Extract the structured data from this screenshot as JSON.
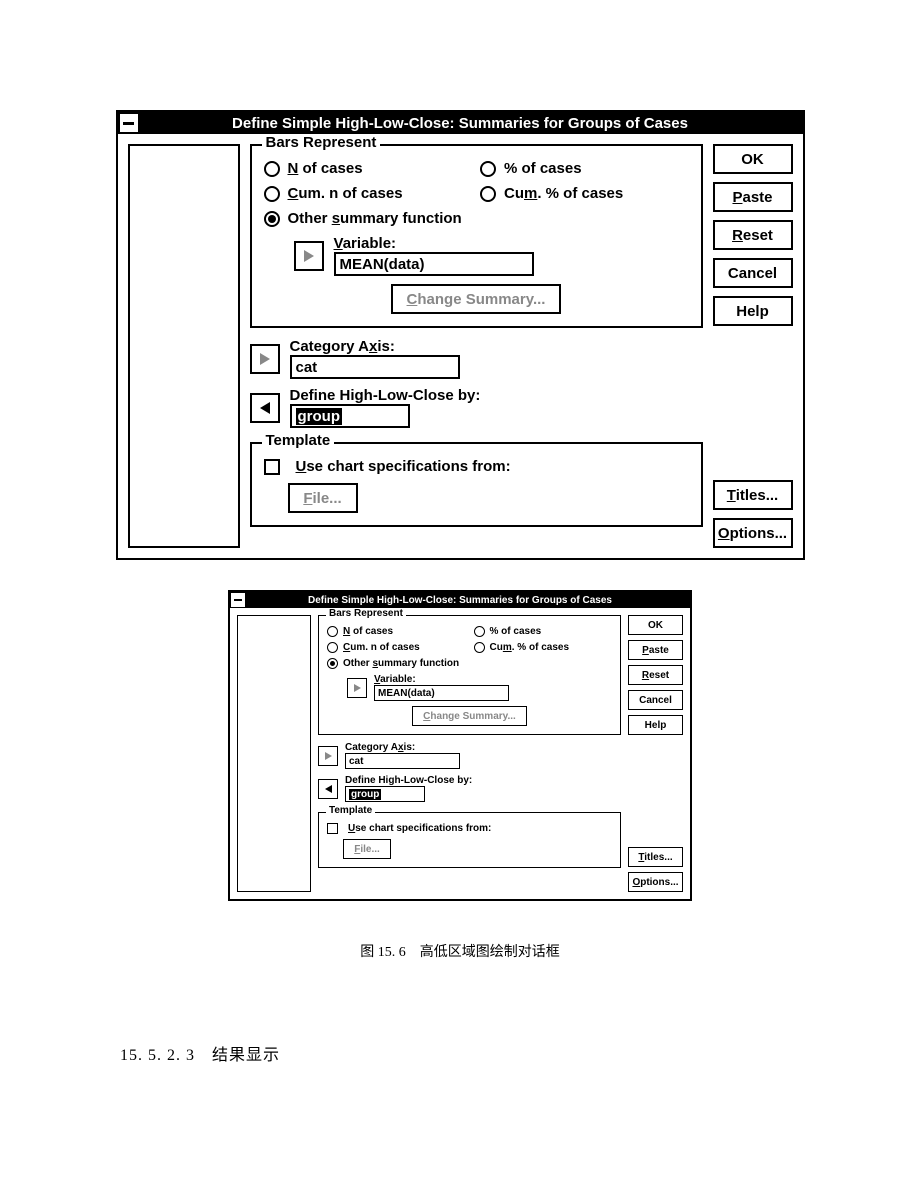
{
  "dialog": {
    "title": "Define Simple High-Low-Close: Summaries for Groups of Cases",
    "bars_legend": "Bars Represent",
    "opts": {
      "n_pre": "N",
      "n_post": " of cases",
      "pct": "% of cases",
      "cum_pre": "C",
      "cum_post": "um. n of cases",
      "cumpct_pre": "Cu",
      "cumpct_u": "m",
      "cumpct_post": ". % of cases",
      "other_pre": "Other ",
      "other_u": "s",
      "other_post": "ummary function"
    },
    "variable_label_u": "V",
    "variable_label_post": "ariable:",
    "variable_value": "MEAN(data)",
    "change_summary": "Change Summary...",
    "cat_label_pre": "Category A",
    "cat_label_u": "x",
    "cat_label_post": "is:",
    "cat_value": "cat",
    "hlc_label": "Define High-Low-Close by:",
    "hlc_value": "group",
    "template_legend": "Template",
    "usechart_u": "U",
    "usechart_post": "se chart specifications from:",
    "file_u": "F",
    "file_post": "ile...",
    "btns": {
      "ok": "OK",
      "paste_u": "P",
      "paste_post": "aste",
      "reset_u": "R",
      "reset_post": "eset",
      "cancel": "Cancel",
      "help": "Help",
      "titles_u": "T",
      "titles_post": "itles...",
      "options_u": "O",
      "options_post": "ptions..."
    }
  },
  "caption": "图 15. 6　高低区域图绘制对话框",
  "section": "15. 5. 2. 3　结果显示"
}
